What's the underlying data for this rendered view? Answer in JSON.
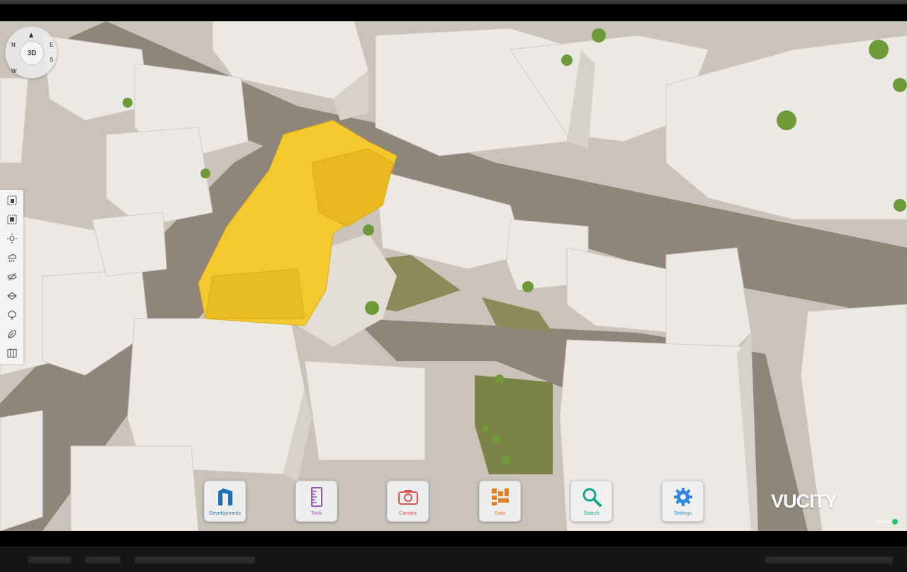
{
  "compass": {
    "mode_label": "3D",
    "directions": [
      "N",
      "E",
      "S",
      "W"
    ]
  },
  "tool_rail": {
    "icons": [
      "select-building-icon",
      "select-area-icon",
      "sun-icon",
      "weather-icon",
      "visibility-icon",
      "layers-icon",
      "tree-icon",
      "leaf-icon",
      "map-icon"
    ]
  },
  "dock": {
    "developments": "Developments",
    "tools": "Tools",
    "camera": "Camera",
    "data": "Data",
    "search": "Search",
    "settings": "Settings"
  },
  "brand": {
    "logo_text": "VUCITY"
  },
  "status": {
    "online_label": "Online",
    "online_color": "#1fc46a"
  },
  "colors": {
    "highlight_building": "#f3c92e",
    "developments_icon": "#1e6fb6",
    "tools_icon": "#9b59b6",
    "camera_icon": "#d9534f",
    "data_icon": "#e67e22",
    "search_icon": "#17a589",
    "settings_icon": "#2e86de"
  }
}
